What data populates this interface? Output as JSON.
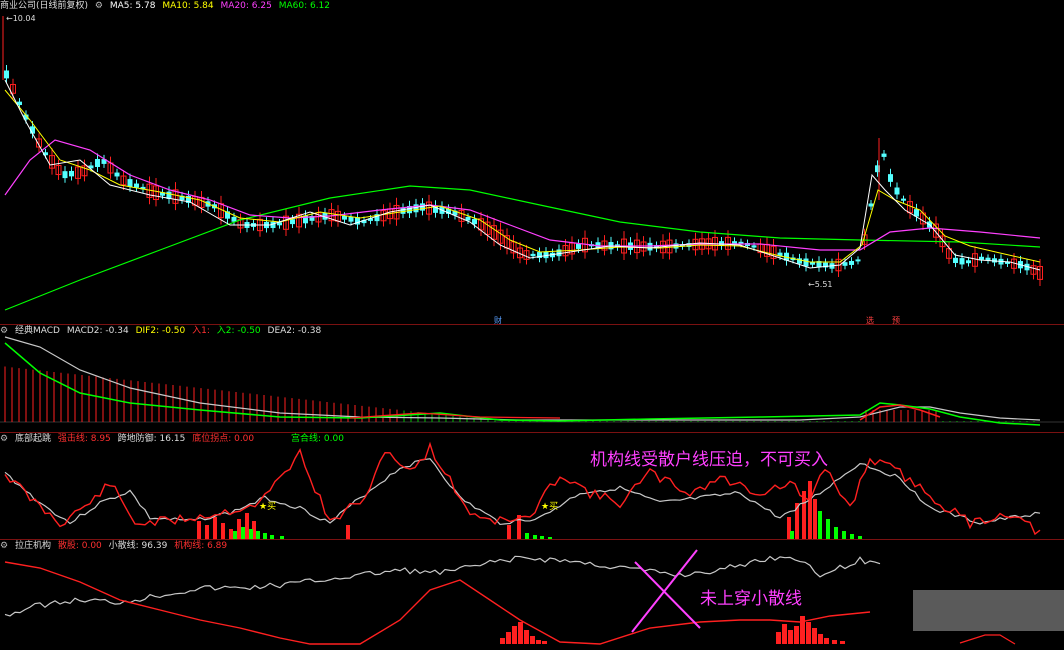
{
  "colors": {
    "up": "#ff2020",
    "down": "#54ffff",
    "ma5": "#ffffff",
    "ma10": "#ffff00",
    "ma20": "#ff40ff",
    "ma60": "#00ff00",
    "grey": "#c8c8c8",
    "bg": "#000000"
  },
  "main": {
    "title": "商业公司(日线前复权)",
    "ma": [
      {
        "label": "MA5: 5.78",
        "color": "#ffffff"
      },
      {
        "label": "MA10: 5.84",
        "color": "#ffff00"
      },
      {
        "label": "MA20: 6.25",
        "color": "#ff40ff"
      },
      {
        "label": "MA60: 6.12",
        "color": "#00ff00"
      }
    ],
    "high_label": "10.04",
    "low_label": "5.51",
    "markers": [
      "财",
      "选",
      "预"
    ]
  },
  "macd": {
    "title": "经典MACD",
    "items": [
      {
        "label": "MACD2: -0.34",
        "color": "#dddddd"
      },
      {
        "label": "DIF2: -0.50",
        "color": "#ffff00"
      },
      {
        "label": "入1: ",
        "color": "#ff3030"
      },
      {
        "label": "入2: -0.50",
        "color": "#00ff00"
      },
      {
        "label": "DEA2: -0.38",
        "color": "#dddddd"
      }
    ]
  },
  "bottom_top": {
    "title": "底部起跳",
    "items": [
      {
        "label": "强击线: 8.95",
        "color": "#ff3030"
      },
      {
        "label": "跨地防御: 16.15",
        "color": "#dddddd"
      },
      {
        "label": "底位拐点: 0.00",
        "color": "#ff3030"
      },
      {
        "label": "宫合线: 0.00",
        "color": "#00ff00"
      }
    ],
    "buy_label": "★买",
    "annotation": "机构线受散户线压迫，不可买入"
  },
  "chip": {
    "title": "拉庄机构",
    "items": [
      {
        "label": "散股: 0.00",
        "color": "#ff3030"
      },
      {
        "label": "小散线: 96.39",
        "color": "#dddddd"
      },
      {
        "label": "机构线: 6.89",
        "color": "#ff3030"
      }
    ],
    "annotation": "未上穿小散线"
  }
}
